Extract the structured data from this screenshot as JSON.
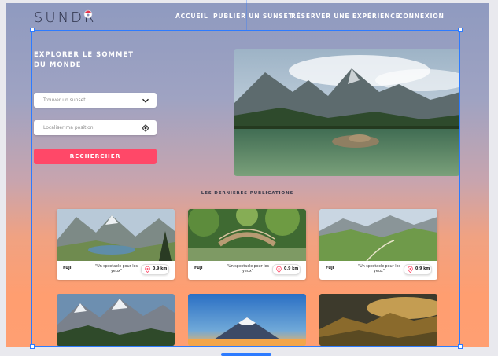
{
  "header": {
    "logo": "SUNDR",
    "nav": [
      "ACCUEIL",
      "PUBLIER UN SUNSET",
      "RÉSERVER UNE EXPÉRIENCE",
      "CONNEXION"
    ]
  },
  "hero": {
    "title_line1": "EXPLORER LE SOMMET",
    "title_line2": "DU MONDE",
    "search_placeholder": "Trouver un sunset",
    "locate_placeholder": "Localiser ma position",
    "search_button": "RECHERCHER"
  },
  "section": {
    "title": "LES DERNIÈRES PUBLICATIONS"
  },
  "cards": [
    {
      "name": "Fuji",
      "quote": "\"Un spectacle pour les yeux\"",
      "distance": "0,9 km"
    },
    {
      "name": "Fuji",
      "quote": "\"Un spectacle pour les yeux\"",
      "distance": "0,9 km"
    },
    {
      "name": "Fuji",
      "quote": "\"Un spectacle pour les yeux\"",
      "distance": "0,9 km"
    }
  ],
  "colors": {
    "accent": "#ff4868",
    "selection": "#2d7bff"
  }
}
